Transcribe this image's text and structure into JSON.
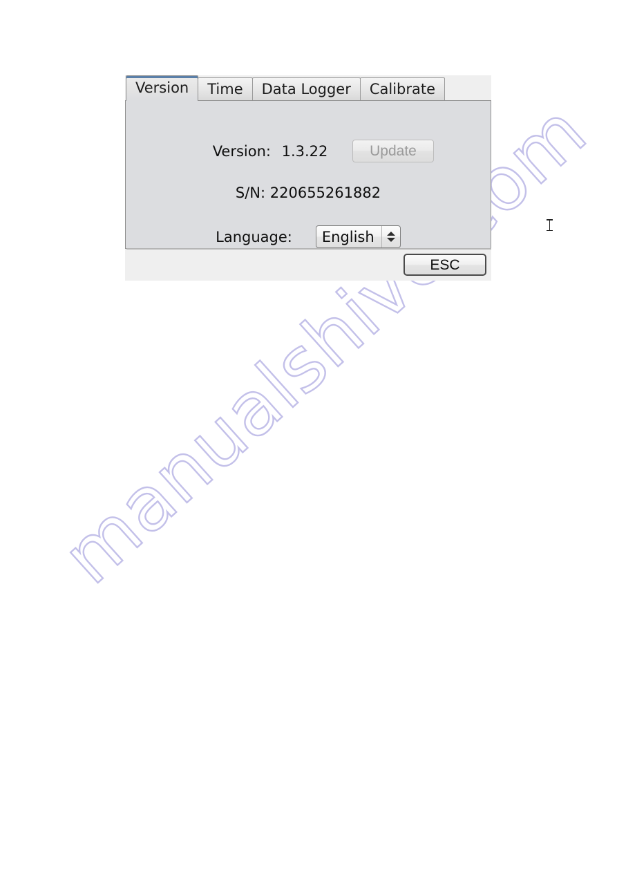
{
  "dialog": {
    "tabs": [
      {
        "label": "Version",
        "active": true
      },
      {
        "label": "Time",
        "active": false
      },
      {
        "label": "Data Logger",
        "active": false
      },
      {
        "label": "Calibrate",
        "active": false
      }
    ],
    "version_row": {
      "label": "Version:",
      "value": "1.3.22",
      "update_button": "Update",
      "update_enabled": false
    },
    "serial_row": {
      "text": "S/N: 220655261882"
    },
    "language_row": {
      "label": "Language:",
      "selected": "English",
      "options": [
        "English"
      ]
    },
    "footer": {
      "esc_button": "ESC"
    }
  },
  "watermark": {
    "text": "manualshive.com",
    "color": "#b9b6e6"
  },
  "colors": {
    "tab_active_accent": "#5a7fa8",
    "panel_bg": "#dcdde0",
    "strip_bg": "#efefef",
    "disabled_text": "#9a9a9a"
  }
}
